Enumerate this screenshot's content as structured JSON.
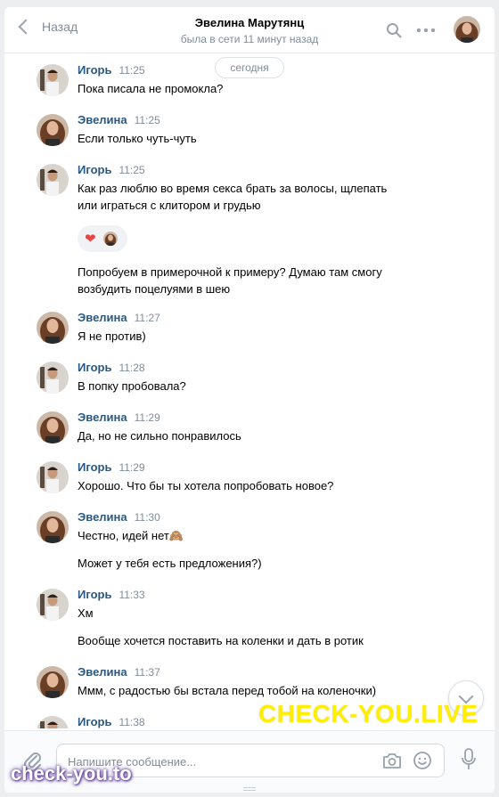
{
  "header": {
    "back_label": "Назад",
    "contact_name": "Эвелина Марутянц",
    "status": "была в сети 11 минут назад",
    "search_icon": "search-icon",
    "more_icon": "more-icon"
  },
  "date_separator": "сегодня",
  "messages": [
    {
      "author": "Игорь",
      "time": "11:25",
      "avatar": "male",
      "lines": [
        "Пока писала не промокла?"
      ]
    },
    {
      "author": "Эвелина",
      "time": "11:25",
      "avatar": "female",
      "lines": [
        "Если только чуть-чуть"
      ]
    },
    {
      "author": "Игорь",
      "time": "11:25",
      "avatar": "male",
      "lines": [
        "Как раз люблю во время секса брать за волосы, щлепать",
        "или играться с клитором и грудью"
      ],
      "reaction": "❤",
      "lines_after": [
        "Попробуем в примерочной к примеру? Думаю там смогу",
        "возбудить поцелуями в шею"
      ]
    },
    {
      "author": "Эвелина",
      "time": "11:27",
      "avatar": "female",
      "lines": [
        "Я не против)"
      ]
    },
    {
      "author": "Игорь",
      "time": "11:28",
      "avatar": "male",
      "lines": [
        "В попку пробовала?"
      ]
    },
    {
      "author": "Эвелина",
      "time": "11:29",
      "avatar": "female",
      "lines": [
        "Да, но не сильно понравилось"
      ]
    },
    {
      "author": "Игорь",
      "time": "11:29",
      "avatar": "male",
      "lines": [
        "Хорошо. Что бы ты хотела попробовать новое?"
      ]
    },
    {
      "author": "Эвелина",
      "time": "11:30",
      "avatar": "female",
      "lines": [
        "Честно, идей нет🙈",
        "Может у тебя есть предложения?)"
      ]
    },
    {
      "author": "Игорь",
      "time": "11:33",
      "avatar": "male",
      "lines": [
        "Хм",
        "Вообще хочется поставить на коленки и дать в ротик"
      ]
    },
    {
      "author": "Эвелина",
      "time": "11:37",
      "avatar": "female",
      "lines": [
        "Ммм, с радостью бы встала перед тобой на коленочки)"
      ]
    },
    {
      "author": "Игорь",
      "time": "11:38",
      "avatar": "male",
      "lines": []
    }
  ],
  "composer": {
    "placeholder": "Напишите сообщение...",
    "value": ""
  },
  "watermarks": {
    "main": "CHECK-YOU.LIVE",
    "corner": "check-you.to"
  },
  "colors": {
    "author_link": "#2a5885",
    "secondary_text": "#818c99",
    "background": "#edeef0",
    "watermark_yellow": "#ffee00"
  }
}
